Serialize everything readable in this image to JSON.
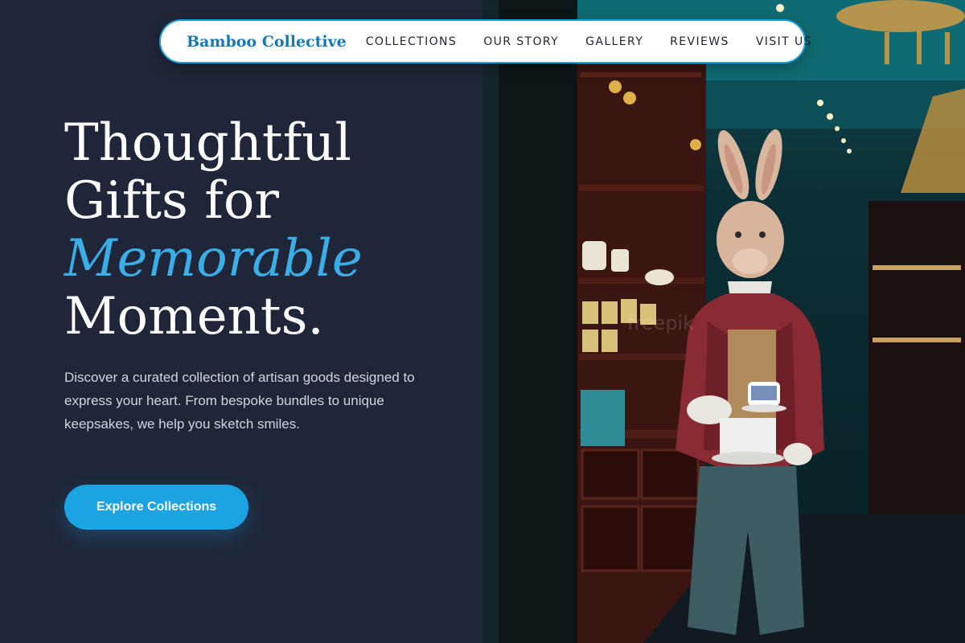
{
  "nav": {
    "brand": "Bamboo Collective",
    "links": [
      "COLLECTIONS",
      "OUR STORY",
      "GALLERY",
      "REVIEWS",
      "VISIT US"
    ]
  },
  "hero": {
    "title_line1": "Thoughtful",
    "title_line2": "Gifts for",
    "title_accent": "Memorable",
    "title_line4": "Moments.",
    "description": "Discover a curated collection of artisan goods designed to express your heart. From bespoke bundles to unique keepsakes, we help you sketch smiles.",
    "cta_label": "Explore Collections"
  },
  "image": {
    "subject": "rabbit-statue-in-tea-shop",
    "watermark": "freepik"
  },
  "colors": {
    "background": "#1f2639",
    "accent": "#3aaee6",
    "button": "#1ba3e3",
    "brand": "#1679b5"
  }
}
